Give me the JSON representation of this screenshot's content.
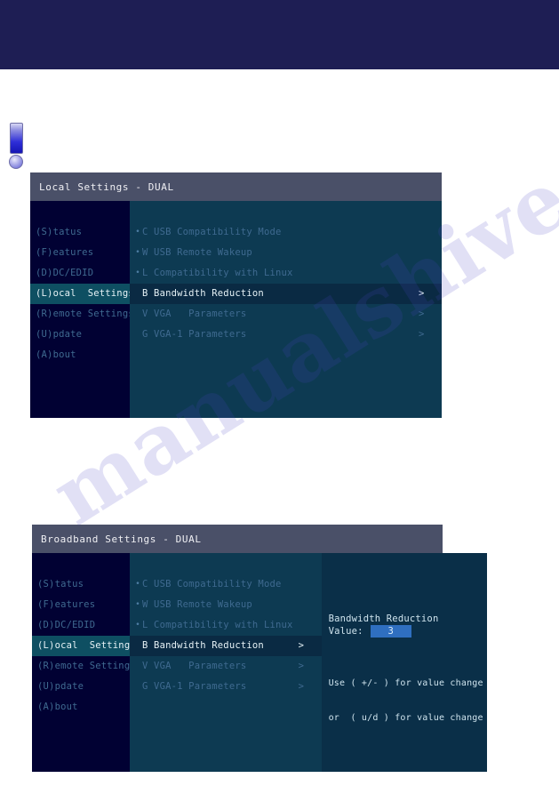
{
  "page": {
    "watermark": "manualshive.com",
    "warning_icon": "exclamation-icon"
  },
  "panels": [
    {
      "id": "local-settings",
      "title": "Local Settings - DUAL",
      "sidebar": [
        {
          "label": "(S)tatus",
          "active": false
        },
        {
          "label": "(F)eatures",
          "active": false
        },
        {
          "label": "(D)DC/EDID",
          "active": false
        },
        {
          "label": "(L)ocal  Settings",
          "active": true
        },
        {
          "label": "(R)emote Settings",
          "active": false
        },
        {
          "label": "(U)pdate",
          "active": false
        },
        {
          "label": "(A)bout",
          "active": false
        }
      ],
      "menu": [
        {
          "bullet": "•",
          "label": "C USB Compatibility Mode",
          "arrow": "",
          "active": false
        },
        {
          "bullet": "•",
          "label": "W USB Remote Wakeup",
          "arrow": "",
          "active": false
        },
        {
          "bullet": "•",
          "label": "L Compatibility with Linux",
          "arrow": "",
          "active": false
        },
        {
          "bullet": "",
          "label": "B Bandwidth Reduction",
          "arrow": ">",
          "active": true
        },
        {
          "bullet": "",
          "label": "V VGA   Parameters",
          "arrow": ">",
          "active": false
        },
        {
          "bullet": "",
          "label": "G VGA-1 Parameters",
          "arrow": ">",
          "active": false
        }
      ]
    },
    {
      "id": "broadband-settings",
      "title": "Broadband Settings - DUAL",
      "sidebar": [
        {
          "label": "(S)tatus",
          "active": false
        },
        {
          "label": "(F)eatures",
          "active": false
        },
        {
          "label": "(D)DC/EDID",
          "active": false
        },
        {
          "label": "(L)ocal  Settings",
          "active": true
        },
        {
          "label": "(R)emote Settings",
          "active": false
        },
        {
          "label": "(U)pdate",
          "active": false
        },
        {
          "label": "(A)bout",
          "active": false
        }
      ],
      "menu": [
        {
          "bullet": "•",
          "label": "C USB Compatibility Mode",
          "arrow": "",
          "active": false
        },
        {
          "bullet": "•",
          "label": "W USB Remote Wakeup",
          "arrow": "",
          "active": false
        },
        {
          "bullet": "•",
          "label": "L Compatibility with Linux",
          "arrow": "",
          "active": false
        },
        {
          "bullet": "",
          "label": "B Bandwidth Reduction",
          "arrow": ">",
          "active": true
        },
        {
          "bullet": "",
          "label": "V VGA   Parameters",
          "arrow": ">",
          "active": false
        },
        {
          "bullet": "",
          "label": "G VGA-1 Parameters",
          "arrow": ">",
          "active": false
        }
      ],
      "info": {
        "heading": "Bandwidth Reduction",
        "value_label": "Value:",
        "value": "3",
        "hint_line1": "Use ( +/- ) for value change",
        "hint_line2": "or  ( u/d ) for value change"
      }
    }
  ],
  "colors": {
    "brand_band": "#1e1e54",
    "title_bar": "#4a5068",
    "sidebar_bg": "#010133",
    "menu_bg": "#0d3a52",
    "info_bg": "#0a2f48",
    "sidebar_active": "#0e4f62",
    "menu_active": "#0a2a43",
    "value_highlight": "#2f6fc0",
    "dim_text": "#3f6a90",
    "bright_text": "#e6f2f6"
  }
}
